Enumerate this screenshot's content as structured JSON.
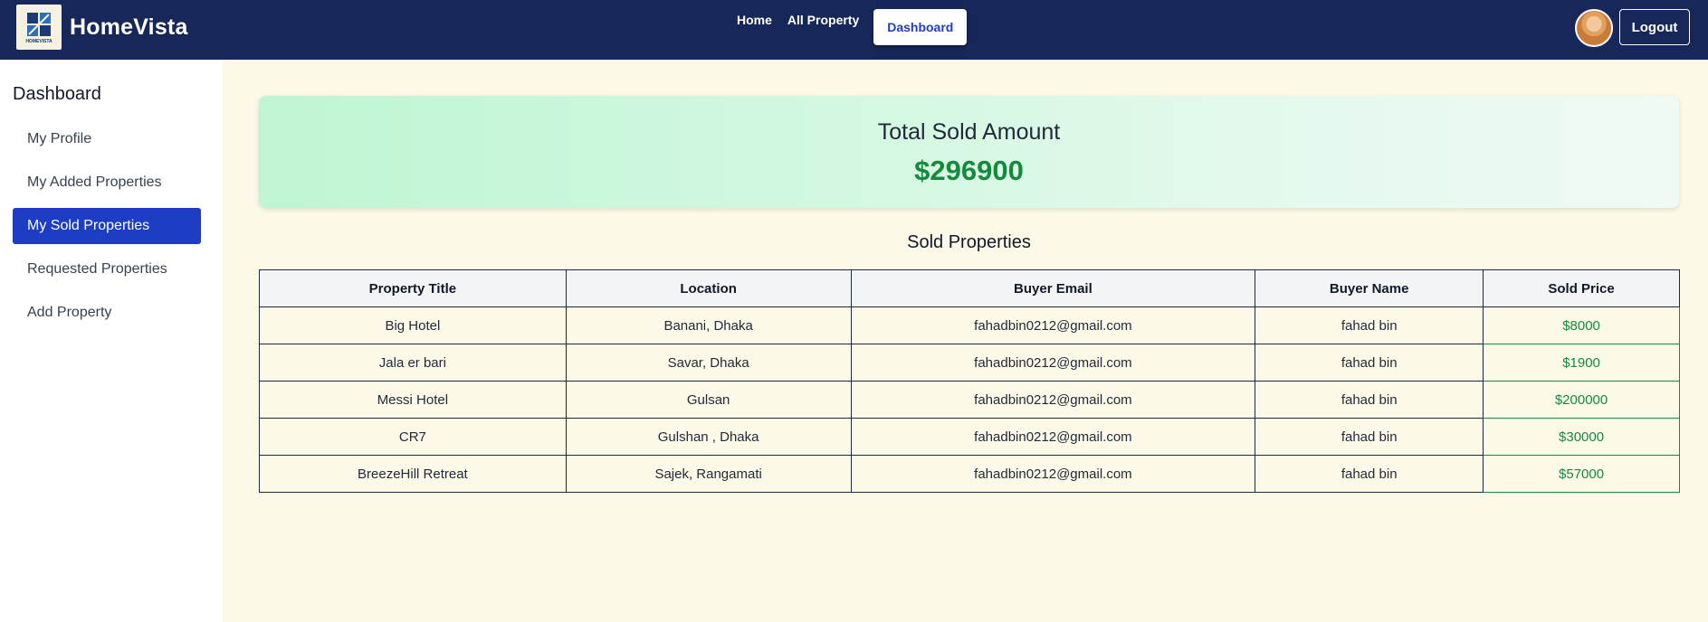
{
  "navbar": {
    "logo_text": "HOMEVISTA",
    "brand": "HomeVista",
    "links": [
      "Home",
      "All Property"
    ],
    "active_button": "Dashboard",
    "logout_label": "Logout"
  },
  "sidebar": {
    "title": "Dashboard",
    "items": [
      {
        "label": "My Profile",
        "active": false
      },
      {
        "label": "My Added Properties",
        "active": false
      },
      {
        "label": "My Sold Properties",
        "active": true
      },
      {
        "label": "Requested Properties",
        "active": false
      },
      {
        "label": "Add Property",
        "active": false
      }
    ]
  },
  "summary": {
    "title": "Total Sold Amount",
    "amount": "$296900"
  },
  "sold_section": {
    "title": "Sold Properties",
    "columns": [
      "Property Title",
      "Location",
      "Buyer Email",
      "Buyer Name",
      "Sold Price"
    ],
    "rows": [
      [
        "Big Hotel",
        "Banani, Dhaka",
        "fahadbin0212@gmail.com",
        "fahad bin",
        "$8000"
      ],
      [
        "Jala er bari",
        "Savar, Dhaka",
        "fahadbin0212@gmail.com",
        "fahad bin",
        "$1900"
      ],
      [
        "Messi Hotel",
        "Gulsan",
        "fahadbin0212@gmail.com",
        "fahad bin",
        "$200000"
      ],
      [
        "CR7",
        "Gulshan , Dhaka",
        "fahadbin0212@gmail.com",
        "fahad bin",
        "$30000"
      ],
      [
        "BreezeHill Retreat",
        "Sajek, Rangamati",
        "fahadbin0212@gmail.com",
        "fahad bin",
        "$57000"
      ]
    ]
  },
  "colors": {
    "navbar_bg": "#18275a",
    "accent_blue": "#1d3ec4",
    "money_green": "#168a3c",
    "page_bg": "#fdf9e8"
  }
}
